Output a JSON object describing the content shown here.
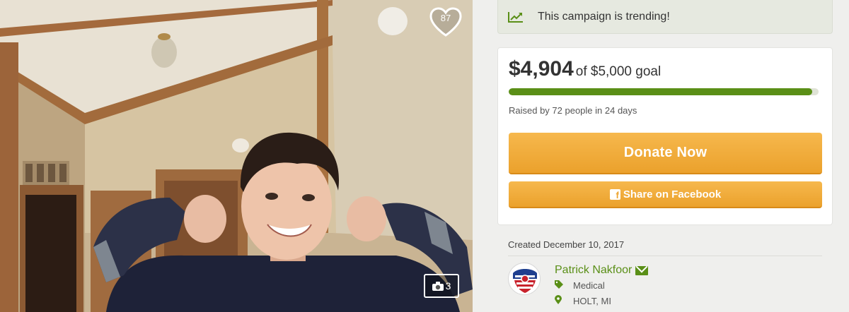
{
  "photo": {
    "heart_icon": "heart-icon",
    "heart_count": "87",
    "camera_icon": "camera-icon",
    "photo_count": "3"
  },
  "trend": {
    "icon": "trending-chart-icon",
    "text": "This campaign is trending!"
  },
  "donation": {
    "amount": "$4,904",
    "goal_text": "of $5,000 goal",
    "progress_fraction": 0.98,
    "raised_text": "Raised by 72 people in 24 days",
    "donate_label": "Donate Now",
    "share_label": "Share on Facebook"
  },
  "campaign": {
    "created_text": "Created December 10, 2017",
    "organizer_name": "Patrick Nakfoor",
    "category": "Medical",
    "location": "HOLT, MI"
  },
  "colors": {
    "accent_green": "#5a8f17",
    "donate_orange": "#eba12c"
  }
}
